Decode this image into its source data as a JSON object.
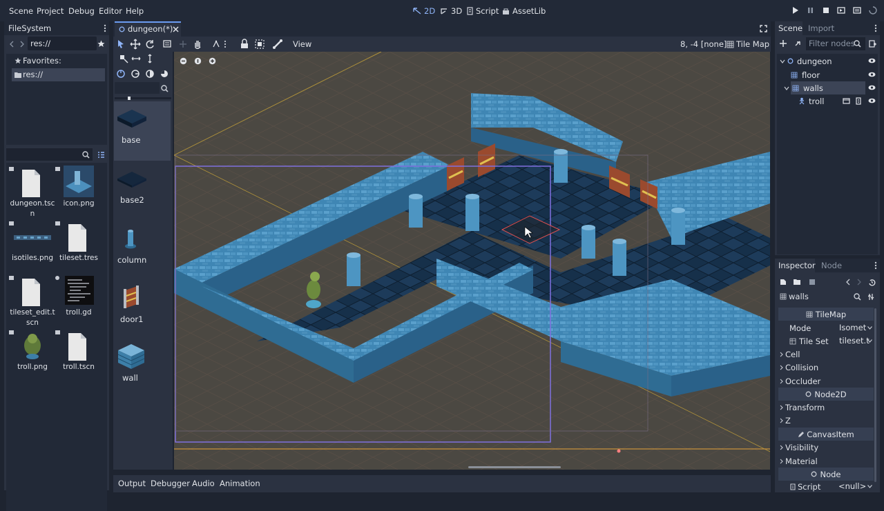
{
  "menu": {
    "scene": "Scene",
    "project": "Project",
    "debug": "Debug",
    "editor": "Editor",
    "help": "Help"
  },
  "workspaces": {
    "two_d": "2D",
    "three_d": "3D",
    "script": "Script",
    "assetlib": "AssetLib"
  },
  "filesystem": {
    "tab_title": "FileSystem",
    "path": "res://",
    "favorites_label": "Favorites:",
    "root_label": "res://",
    "files": [
      {
        "name": "dungeon.tscn",
        "kind": "doc"
      },
      {
        "name": "icon.png",
        "kind": "image"
      },
      {
        "name": "isotiles.png",
        "kind": "image"
      },
      {
        "name": "tileset.tres",
        "kind": "doc"
      },
      {
        "name": "tileset_edit.tscn",
        "kind": "doc"
      },
      {
        "name": "troll.gd",
        "kind": "script"
      },
      {
        "name": "troll.png",
        "kind": "image"
      },
      {
        "name": "troll.tscn",
        "kind": "doc"
      }
    ]
  },
  "editor_tab": {
    "title": "dungeon(*)"
  },
  "viewport_toolbar": {
    "view_label": "View",
    "coords": "8, -4 [none]",
    "tilemap_label": "Tile Map"
  },
  "palette": {
    "items": [
      "base",
      "base2",
      "column",
      "door1",
      "wall"
    ]
  },
  "bottom_tabs": {
    "output": "Output",
    "debugger": "Debugger",
    "audio": "Audio",
    "animation": "Animation"
  },
  "scene_dock": {
    "tab_scene": "Scene",
    "tab_import": "Import",
    "filter_placeholder": "Filter nodes",
    "nodes": [
      {
        "label": "dungeon",
        "kind": "node2d"
      },
      {
        "label": "floor",
        "kind": "tilemap"
      },
      {
        "label": "walls",
        "kind": "tilemap"
      },
      {
        "label": "troll",
        "kind": "kinematic"
      }
    ]
  },
  "inspector": {
    "tab_inspector": "Inspector",
    "tab_node": "Node",
    "object_name": "walls",
    "section_tilemap": "TileMap",
    "mode_label": "Mode",
    "mode_value": "Isomet",
    "tileset_label": "Tile Set",
    "tileset_value": "tileset.t",
    "cell": "Cell",
    "collision": "Collision",
    "occluder": "Occluder",
    "section_node2d": "Node2D",
    "transform": "Transform",
    "z": "Z",
    "section_canvasitem": "CanvasItem",
    "visibility": "Visibility",
    "material": "Material",
    "section_node": "Node",
    "script_label": "Script",
    "script_value": "<null>"
  },
  "colors": {
    "accent": "#6b9cf2",
    "bg": "#222937",
    "panel": "#2b3241",
    "viewport": "#4b4842",
    "wall": "#3d7fa8",
    "floor": "#12233a"
  }
}
